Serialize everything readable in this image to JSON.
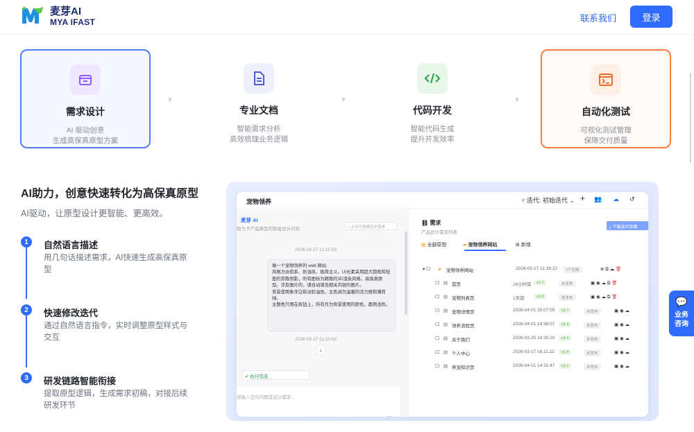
{
  "header": {
    "logo_cn": "麦芽AI",
    "logo_en": "MYA IFAST",
    "contact_label": "联系我们",
    "login_label": "登录"
  },
  "steps": [
    {
      "title": "需求设计",
      "desc1": "AI 驱动创意",
      "desc2": "生成高保真原型方案",
      "icon": "box-icon"
    },
    {
      "title": "专业文档",
      "desc1": "智能需求分析",
      "desc2": "高效梳理业务逻辑",
      "icon": "document-icon"
    },
    {
      "title": "代码开发",
      "desc1": "智能代码生成",
      "desc2": "提升开发效率",
      "icon": "code-icon"
    },
    {
      "title": "自动化测试",
      "desc1": "可视化测试管理",
      "desc2": "保障交付质量",
      "icon": "terminal-icon"
    }
  ],
  "section": {
    "title": "AI助力，创意快速转化为高保真原型",
    "subtitle": "AI驱动，让原型设计更智能、更高效。",
    "items": [
      {
        "num": "1",
        "title": "自然语言描述",
        "desc": "用几句话描述需求，AI快速生成高保真原型"
      },
      {
        "num": "2",
        "title": "快速修改迭代",
        "desc": "通过自然语言指令，实时调整原型样式与交互"
      },
      {
        "num": "3",
        "title": "研发链路智能衔接",
        "desc": "提取原型逻辑，生成需求初稿，对接后续研发环节"
      }
    ]
  },
  "preview": {
    "app_title": "宠物领养",
    "iteration": "迭代: 初始迭代",
    "brand": "麦芽 AI",
    "brand_sub": "助力于产品原型的智能设计问答",
    "search_placeholder": "点击可搜索历史需求",
    "time1": "2026-03-17 11:15:53",
    "message": "做一个宠物领养的 web 网站\n风格为治愈系、奶油风、极简主义。UI元素采用超大圆角和轻盈的弥散阴影，所有图标为精致的3D渲染风格，高保真原型。涉及图片的，请自动填充相关内容的图片。\n背景使用象牙白和淡奶油色，主色调为温暖的活力橙和薄荷绿。\n主题色只用在按钮上，所有作为背景使用的颜色，都用浅色。",
    "time2": "2026-03-17 11:15:53",
    "done_label": "执行完成",
    "input_placeholder": "请输入您的问题或设计需求...",
    "mode_label": "自动",
    "req_title": "需求",
    "req_sub": "产品设计需求列表",
    "download_label": "下载选中页面",
    "tabs": [
      "全部原型",
      "宠物领养网站",
      "新增"
    ],
    "root": {
      "name": "宠物领养网站",
      "date": "2026-03-17 11:16:22",
      "badge": "7个页面"
    },
    "rows": [
      {
        "name": "首页",
        "date": "16小时前",
        "ver": "v1.7",
        "status": "未发布"
      },
      {
        "name": "宠物列表页",
        "date": "1天前",
        "ver": "v1.3",
        "status": "未发布"
      },
      {
        "name": "宠物详情页",
        "date": "2026-04-01 15:07:00",
        "ver": "v1.7",
        "status": "未发布"
      },
      {
        "name": "领养流程页",
        "date": "2026-04-01 14:38:07",
        "ver": "v1.4",
        "status": "未发布"
      },
      {
        "name": "关于我们",
        "date": "2026-03-25 18:39:20",
        "ver": "v1.4",
        "status": "未发布"
      },
      {
        "name": "个人中心",
        "date": "2026-03-17 16:11:22",
        "ver": "v1.4",
        "status": "未发布"
      },
      {
        "name": "养宠知识页",
        "date": "2026-04-01 14:31:47",
        "ver": "v1.1",
        "status": "未发布"
      }
    ]
  },
  "float": {
    "line1": "业务",
    "line2": "咨询"
  }
}
